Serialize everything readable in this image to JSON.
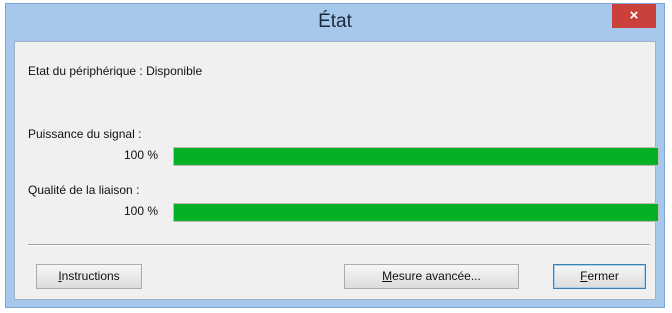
{
  "window": {
    "title": "État",
    "close_glyph": "×"
  },
  "device_status": "Etat du périphérique : Disponible",
  "signal": {
    "label": "Puissance du signal :",
    "percent_text": "100 %",
    "value_percent": 100
  },
  "link": {
    "label": "Qualité de la liaison :",
    "percent_text": "100 %",
    "value_percent": 100
  },
  "buttons": {
    "instructions_first": "I",
    "instructions_rest": "nstructions",
    "advanced_first": "M",
    "advanced_rest": "esure avancée...",
    "close_first": "F",
    "close_rest": "ermer"
  },
  "colors": {
    "bar_fill": "#06b025",
    "close_button": "#c9413a",
    "titlebar": "#a6c8ec"
  }
}
